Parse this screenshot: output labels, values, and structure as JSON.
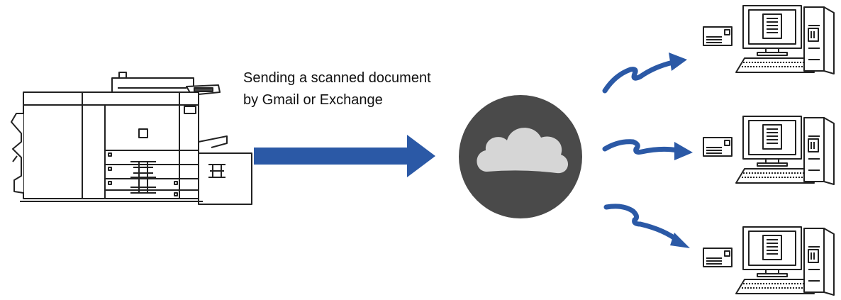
{
  "diagram": {
    "caption": {
      "line1": "Sending a scanned document",
      "line2": "by Gmail or Exchange"
    },
    "nodes": [
      {
        "id": "mfp",
        "icon": "multifunction-printer-icon"
      },
      {
        "id": "cloud",
        "icon": "cloud-icon"
      },
      {
        "id": "pc1",
        "icon": "desktop-computer-icon"
      },
      {
        "id": "pc2",
        "icon": "desktop-computer-icon"
      },
      {
        "id": "pc3",
        "icon": "desktop-computer-icon"
      }
    ],
    "colors": {
      "arrow": "#2b59a6",
      "cloud_circle": "#4a4a4a",
      "cloud_shape": "#d6d6d6",
      "outline": "#222222"
    }
  }
}
